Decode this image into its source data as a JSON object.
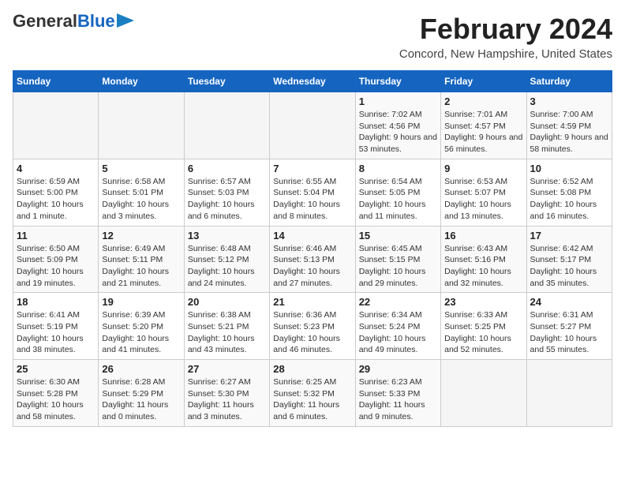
{
  "header": {
    "logo_general": "General",
    "logo_blue": "Blue",
    "title": "February 2024",
    "subtitle": "Concord, New Hampshire, United States"
  },
  "calendar": {
    "days_of_week": [
      "Sunday",
      "Monday",
      "Tuesday",
      "Wednesday",
      "Thursday",
      "Friday",
      "Saturday"
    ],
    "weeks": [
      [
        {
          "day": "",
          "info": ""
        },
        {
          "day": "",
          "info": ""
        },
        {
          "day": "",
          "info": ""
        },
        {
          "day": "",
          "info": ""
        },
        {
          "day": "1",
          "info": "Sunrise: 7:02 AM\nSunset: 4:56 PM\nDaylight: 9 hours and 53 minutes."
        },
        {
          "day": "2",
          "info": "Sunrise: 7:01 AM\nSunset: 4:57 PM\nDaylight: 9 hours and 56 minutes."
        },
        {
          "day": "3",
          "info": "Sunrise: 7:00 AM\nSunset: 4:59 PM\nDaylight: 9 hours and 58 minutes."
        }
      ],
      [
        {
          "day": "4",
          "info": "Sunrise: 6:59 AM\nSunset: 5:00 PM\nDaylight: 10 hours and 1 minute."
        },
        {
          "day": "5",
          "info": "Sunrise: 6:58 AM\nSunset: 5:01 PM\nDaylight: 10 hours and 3 minutes."
        },
        {
          "day": "6",
          "info": "Sunrise: 6:57 AM\nSunset: 5:03 PM\nDaylight: 10 hours and 6 minutes."
        },
        {
          "day": "7",
          "info": "Sunrise: 6:55 AM\nSunset: 5:04 PM\nDaylight: 10 hours and 8 minutes."
        },
        {
          "day": "8",
          "info": "Sunrise: 6:54 AM\nSunset: 5:05 PM\nDaylight: 10 hours and 11 minutes."
        },
        {
          "day": "9",
          "info": "Sunrise: 6:53 AM\nSunset: 5:07 PM\nDaylight: 10 hours and 13 minutes."
        },
        {
          "day": "10",
          "info": "Sunrise: 6:52 AM\nSunset: 5:08 PM\nDaylight: 10 hours and 16 minutes."
        }
      ],
      [
        {
          "day": "11",
          "info": "Sunrise: 6:50 AM\nSunset: 5:09 PM\nDaylight: 10 hours and 19 minutes."
        },
        {
          "day": "12",
          "info": "Sunrise: 6:49 AM\nSunset: 5:11 PM\nDaylight: 10 hours and 21 minutes."
        },
        {
          "day": "13",
          "info": "Sunrise: 6:48 AM\nSunset: 5:12 PM\nDaylight: 10 hours and 24 minutes."
        },
        {
          "day": "14",
          "info": "Sunrise: 6:46 AM\nSunset: 5:13 PM\nDaylight: 10 hours and 27 minutes."
        },
        {
          "day": "15",
          "info": "Sunrise: 6:45 AM\nSunset: 5:15 PM\nDaylight: 10 hours and 29 minutes."
        },
        {
          "day": "16",
          "info": "Sunrise: 6:43 AM\nSunset: 5:16 PM\nDaylight: 10 hours and 32 minutes."
        },
        {
          "day": "17",
          "info": "Sunrise: 6:42 AM\nSunset: 5:17 PM\nDaylight: 10 hours and 35 minutes."
        }
      ],
      [
        {
          "day": "18",
          "info": "Sunrise: 6:41 AM\nSunset: 5:19 PM\nDaylight: 10 hours and 38 minutes."
        },
        {
          "day": "19",
          "info": "Sunrise: 6:39 AM\nSunset: 5:20 PM\nDaylight: 10 hours and 41 minutes."
        },
        {
          "day": "20",
          "info": "Sunrise: 6:38 AM\nSunset: 5:21 PM\nDaylight: 10 hours and 43 minutes."
        },
        {
          "day": "21",
          "info": "Sunrise: 6:36 AM\nSunset: 5:23 PM\nDaylight: 10 hours and 46 minutes."
        },
        {
          "day": "22",
          "info": "Sunrise: 6:34 AM\nSunset: 5:24 PM\nDaylight: 10 hours and 49 minutes."
        },
        {
          "day": "23",
          "info": "Sunrise: 6:33 AM\nSunset: 5:25 PM\nDaylight: 10 hours and 52 minutes."
        },
        {
          "day": "24",
          "info": "Sunrise: 6:31 AM\nSunset: 5:27 PM\nDaylight: 10 hours and 55 minutes."
        }
      ],
      [
        {
          "day": "25",
          "info": "Sunrise: 6:30 AM\nSunset: 5:28 PM\nDaylight: 10 hours and 58 minutes."
        },
        {
          "day": "26",
          "info": "Sunrise: 6:28 AM\nSunset: 5:29 PM\nDaylight: 11 hours and 0 minutes."
        },
        {
          "day": "27",
          "info": "Sunrise: 6:27 AM\nSunset: 5:30 PM\nDaylight: 11 hours and 3 minutes."
        },
        {
          "day": "28",
          "info": "Sunrise: 6:25 AM\nSunset: 5:32 PM\nDaylight: 11 hours and 6 minutes."
        },
        {
          "day": "29",
          "info": "Sunrise: 6:23 AM\nSunset: 5:33 PM\nDaylight: 11 hours and 9 minutes."
        },
        {
          "day": "",
          "info": ""
        },
        {
          "day": "",
          "info": ""
        }
      ]
    ]
  }
}
